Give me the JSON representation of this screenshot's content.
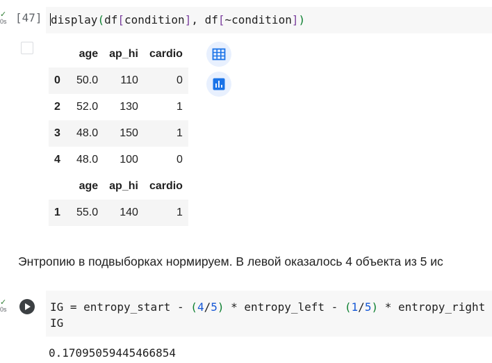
{
  "cell1": {
    "exec_time": "0s",
    "prompt": "[47]",
    "code": {
      "fn": "display",
      "p1": "(",
      "df1": "df",
      "b1": "[",
      "arg1": "condition",
      "b2": "]",
      "sep": ", ",
      "df2": "df",
      "b3": "[",
      "arg2": "~condition",
      "b4": "]",
      "p2": ")"
    },
    "tables": [
      {
        "columns": [
          "age",
          "ap_hi",
          "cardio"
        ],
        "rows": [
          {
            "index": "0",
            "age": "50.0",
            "ap_hi": "110",
            "cardio": "0"
          },
          {
            "index": "2",
            "age": "52.0",
            "ap_hi": "130",
            "cardio": "1"
          },
          {
            "index": "3",
            "age": "48.0",
            "ap_hi": "150",
            "cardio": "1"
          },
          {
            "index": "4",
            "age": "48.0",
            "ap_hi": "100",
            "cardio": "0"
          }
        ]
      },
      {
        "columns": [
          "age",
          "ap_hi",
          "cardio"
        ],
        "rows": [
          {
            "index": "1",
            "age": "55.0",
            "ap_hi": "140",
            "cardio": "1"
          }
        ]
      }
    ],
    "buttons": {
      "table_icon": "table-icon",
      "chart_icon": "bar-chart-icon",
      "accent": "#1a73e8",
      "bg": "#e8f0fe"
    }
  },
  "markdown": "Энтропию в подвыборках нормируем. В левой оказалось 4 объекта из 5 ис",
  "cell2": {
    "exec_time": "0s",
    "line1": {
      "a": "IG = entropy_start - ",
      "lp1": "(",
      "n1": "4",
      "s1": "/",
      "n2": "5",
      "rp1": ")",
      "b": " * entropy_left - ",
      "lp2": "(",
      "n3": "1",
      "s2": "/",
      "n4": "5",
      "rp2": ")",
      "c": " * entropy_right"
    },
    "line2": "IG",
    "output": "0.17095059445466854"
  }
}
